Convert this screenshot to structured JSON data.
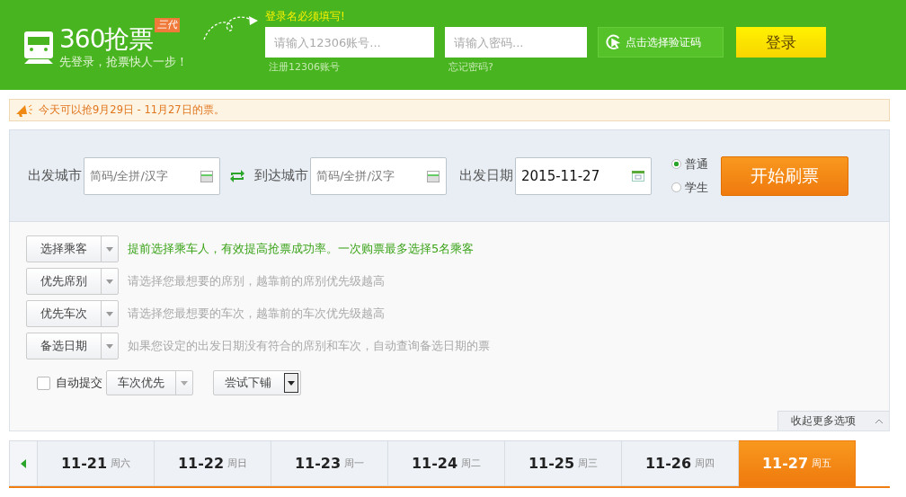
{
  "header": {
    "logo_title": "360抢票",
    "logo_badge": "三代",
    "slogan": "先登录，抢票快人一步！",
    "login_hint": "登录名必须填写!",
    "account": {
      "placeholder": "请输入12306账号..."
    },
    "register_link": "注册12306账号",
    "password": {
      "placeholder": "请输入密码..."
    },
    "forgot_link": "忘记密码?",
    "captcha_button": "点击选择验证码",
    "login_button": "登录"
  },
  "notice": "今天可以抢9月29日 - 11月27日的票。",
  "search": {
    "from_label": "出发城市",
    "from": {
      "placeholder": "简码/全拼/汉字"
    },
    "to_label": "到达城市",
    "to": {
      "placeholder": "简码/全拼/汉字"
    },
    "date_label": "出发日期",
    "date": "2015-11-27",
    "ticket_types": [
      {
        "label": "普通",
        "selected": true
      },
      {
        "label": "学生",
        "selected": false
      }
    ],
    "start_button": "开始刷票"
  },
  "options": [
    {
      "label": "选择乘客",
      "hint": "提前选择乘车人，有效提高抢票成功率。一次购票最多选择5名乘客",
      "highlight": true
    },
    {
      "label": "优先席别",
      "hint": "请选择您最想要的席别，越靠前的席别优先级越高",
      "highlight": false
    },
    {
      "label": "优先车次",
      "hint": "请选择您最想要的车次，越靠前的车次优先级越高",
      "highlight": false
    },
    {
      "label": "备选日期",
      "hint": "如果您设定的出发日期没有符合的席别和车次，自动查询备选日期的票",
      "highlight": false
    }
  ],
  "auto_submit": {
    "label": "自动提交",
    "checked": false,
    "mode": "车次优先",
    "berth": "尝试下铺"
  },
  "collapse_button": "收起更多选项",
  "dates": [
    {
      "date": "11-21",
      "weekday": "周六",
      "selected": false
    },
    {
      "date": "11-22",
      "weekday": "周日",
      "selected": false
    },
    {
      "date": "11-23",
      "weekday": "周一",
      "selected": false
    },
    {
      "date": "11-24",
      "weekday": "周二",
      "selected": false
    },
    {
      "date": "11-25",
      "weekday": "周三",
      "selected": false
    },
    {
      "date": "11-26",
      "weekday": "周四",
      "selected": false
    },
    {
      "date": "11-27",
      "weekday": "周五",
      "selected": true
    }
  ]
}
